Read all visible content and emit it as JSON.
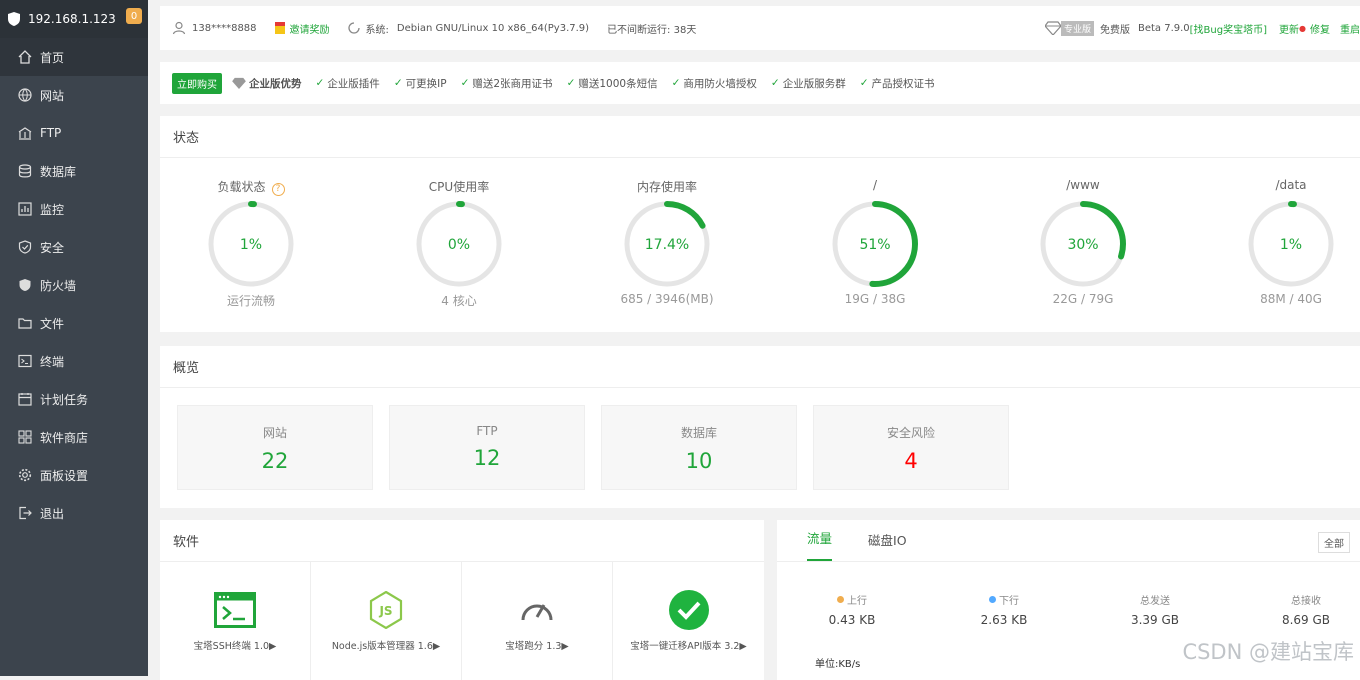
{
  "sidebar": {
    "ip": "192.168.1.123",
    "badge": "0",
    "items": [
      {
        "label": "首页",
        "icon": "home-icon"
      },
      {
        "label": "网站",
        "icon": "globe-icon"
      },
      {
        "label": "FTP",
        "icon": "ftp-icon"
      },
      {
        "label": "数据库",
        "icon": "database-icon"
      },
      {
        "label": "监控",
        "icon": "monitor-icon"
      },
      {
        "label": "安全",
        "icon": "shield-check-icon"
      },
      {
        "label": "防火墙",
        "icon": "firewall-icon"
      },
      {
        "label": "文件",
        "icon": "folder-icon"
      },
      {
        "label": "终端",
        "icon": "terminal-icon"
      },
      {
        "label": "计划任务",
        "icon": "calendar-icon"
      },
      {
        "label": "软件商店",
        "icon": "grid-icon"
      },
      {
        "label": "面板设置",
        "icon": "gear-icon"
      },
      {
        "label": "退出",
        "icon": "logout-icon"
      }
    ]
  },
  "topbar": {
    "user": "138****8888",
    "invite": "邀请奖励",
    "system_label": "系统:",
    "system_value": "Debian GNU/Linux 10 x86_64(Py3.7.9)",
    "uptime": "已不间断运行: 38天",
    "pro_tag": "专业版",
    "edition": "免费版",
    "version": "Beta  7.9.0",
    "bug_bounty": "[找Bug奖宝塔币]",
    "update": "更新",
    "repair": "修复",
    "restart": "重启"
  },
  "advantages": {
    "buy": "立即购买",
    "title": "企业版优势",
    "features": [
      "企业版插件",
      "可更换IP",
      "赠送2张商用证书",
      "赠送1000条短信",
      "商用防火墙授权",
      "企业版服务群",
      "产品授权证书"
    ]
  },
  "status": {
    "title": "状态",
    "gauges": [
      {
        "label": "负载状态",
        "value": "1%",
        "percent": 1,
        "sub": "运行流畅",
        "help": "?"
      },
      {
        "label": "CPU使用率",
        "value": "0%",
        "percent": 0,
        "sub": "4 核心"
      },
      {
        "label": "内存使用率",
        "value": "17.4%",
        "percent": 17.4,
        "sub": "685 / 3946(MB)"
      },
      {
        "label": "/",
        "value": "51%",
        "percent": 51,
        "sub": "19G / 38G"
      },
      {
        "label": "/www",
        "value": "30%",
        "percent": 30,
        "sub": "22G / 79G"
      },
      {
        "label": "/data",
        "value": "1%",
        "percent": 1,
        "sub": "88M / 40G"
      }
    ]
  },
  "overview": {
    "title": "概览",
    "boxes": [
      {
        "label": "网站",
        "value": "22"
      },
      {
        "label": "FTP",
        "value": "12"
      },
      {
        "label": "数据库",
        "value": "10"
      },
      {
        "label": "安全风险",
        "value": "4"
      }
    ]
  },
  "software": {
    "title": "软件",
    "items": [
      {
        "name": "宝塔SSH终端 1.0▶",
        "icon": "terminal-window-icon"
      },
      {
        "name": "Node.js版本管理器 1.6▶",
        "icon": "nodejs-icon"
      },
      {
        "name": "宝塔跑分 1.3▶",
        "icon": "speedometer-icon"
      },
      {
        "name": "宝塔一键迁移API版本 3.2▶",
        "icon": "check-circle-icon"
      }
    ]
  },
  "traffic": {
    "tabs": [
      "流量",
      "磁盘IO"
    ],
    "all_button": "全部",
    "stats": [
      {
        "label": "上行",
        "value": "0.43 KB",
        "dot": "#f0ad4e"
      },
      {
        "label": "下行",
        "value": "2.63 KB",
        "dot": "#52a9ff"
      },
      {
        "label": "总发送",
        "value": "3.39 GB"
      },
      {
        "label": "总接收",
        "value": "8.69 GB"
      }
    ],
    "unit": "单位:KB/s"
  },
  "watermark": "CSDN @建站宝库",
  "colors": {
    "accent": "#20a53a",
    "danger": "#ff0000",
    "sidebar": "#3c444d"
  }
}
